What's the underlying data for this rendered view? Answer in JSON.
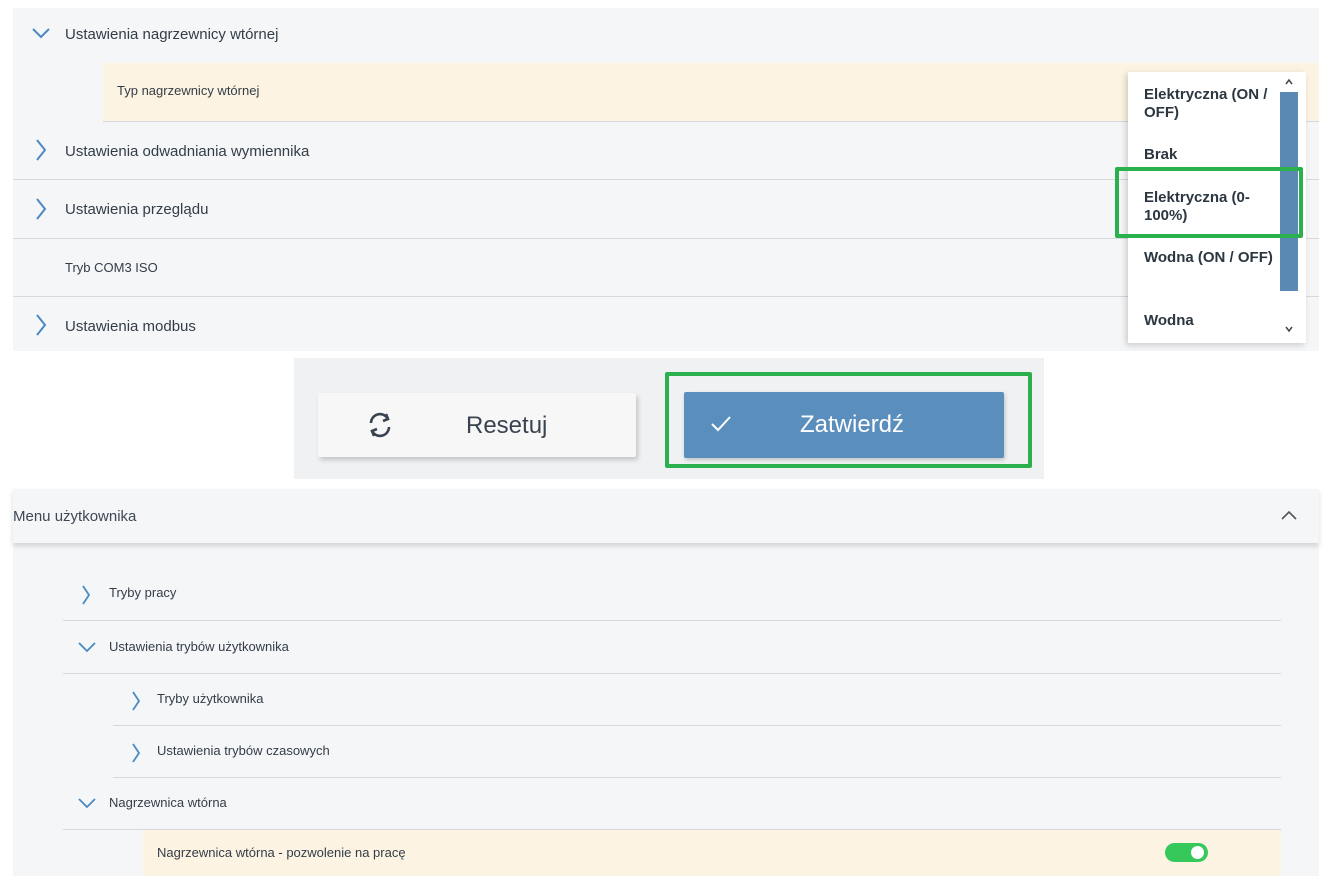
{
  "panel_top": {
    "section_header": "Ustawienia nagrzewnicy wtórnej",
    "sub_item": "Typ nagrzewnicy wtórnej",
    "items": [
      "Ustawienia odwadniania wymiennika",
      "Ustawienia przeglądu",
      "Tryb COM3 ISO",
      "Ustawienia modbus"
    ],
    "dropdown": {
      "options": [
        "Elektryczna (ON / OFF)",
        "Brak",
        "Elektryczna (0-100%)",
        "Wodna (ON / OFF)",
        "Wodna"
      ],
      "highlighted": "Elektryczna (0-100%)",
      "icons": [
        "chevron-up-icon",
        "chevron-down-icon"
      ]
    }
  },
  "buttons": {
    "reset_label": "Resetuj",
    "reset_icon": "refresh-icon",
    "confirm_label": "Zatwierdź",
    "confirm_icon": "check-icon"
  },
  "menu": {
    "header": "Menu użytkownika",
    "items": [
      "Tryby pracy",
      "Ustawienia trybów użytkownika",
      "Tryby użytkownika",
      "Ustawienia trybów czasowych",
      "Nagrzewnica wtórna"
    ],
    "setting_label": "Nagrzewnica wtórna - pozwolenie na pracę",
    "toggle_on": true
  },
  "colors": {
    "accent_blue": "#5a8ebd",
    "highlight_green": "#2bb04e",
    "toggle_green": "#36c85a",
    "row_highlight": "#fdf3e3"
  }
}
